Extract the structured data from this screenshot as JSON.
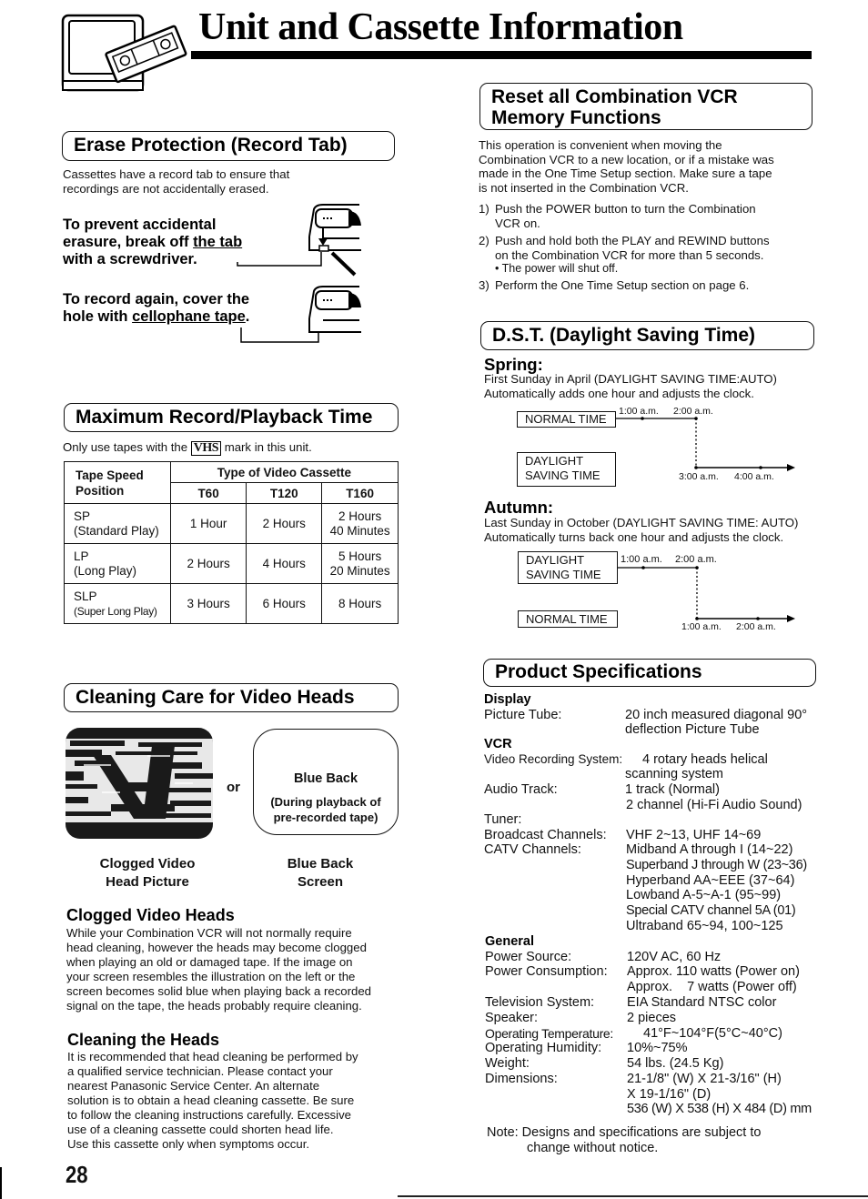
{
  "page": {
    "title": "Unit and Cassette Information",
    "page_number": "28"
  },
  "erase_protection": {
    "heading": "Erase Protection (Record Tab)",
    "intro_line1": "Cassettes have a record tab to ensure that",
    "intro_line2": "recordings are not accidentally erased.",
    "prevent_line1": "To prevent accidental",
    "prevent_line2a": "erasure, break off ",
    "prevent_line2b": "the tab",
    "prevent_line3": "with a screwdriver.",
    "record_line1": "To record again, cover the",
    "record_line2a": "hole with ",
    "record_line2b": "cellophane tape",
    "record_line2c": "."
  },
  "max_time": {
    "heading": "Maximum Record/Playback Time",
    "note_before": "Only use tapes with the",
    "vhs_mark": "VHS",
    "note_after": "mark in this unit.",
    "table": {
      "col0_header_line1": "Tape Speed",
      "col0_header_line2": "Position",
      "group_header": "Type of Video Cassette",
      "columns": [
        "T60",
        "T120",
        "T160"
      ],
      "rows": [
        {
          "speed": "SP",
          "speed_desc": "(Standard Play)",
          "values": [
            "1 Hour",
            "2 Hours",
            "2 Hours",
            "40 Minutes"
          ]
        },
        {
          "speed": "LP",
          "speed_desc": "(Long Play)",
          "values": [
            "2 Hours",
            "4 Hours",
            "5 Hours",
            "20 Minutes"
          ]
        },
        {
          "speed": "SLP",
          "speed_desc": "(Super Long Play)",
          "values": [
            "3 Hours",
            "6 Hours",
            "8 Hours",
            ""
          ]
        }
      ]
    }
  },
  "cleaning": {
    "heading": "Cleaning Care for Video Heads",
    "or_label": "or",
    "blue_back_title": "Blue Back",
    "blue_back_line1": "(During playback of",
    "blue_back_line2": "pre-recorded tape)",
    "caption_left_line1": "Clogged Video",
    "caption_left_line2": "Head Picture",
    "caption_right_line1": "Blue Back",
    "caption_right_line2": "Screen",
    "clogged_heading": "Clogged Video Heads",
    "clogged_lines": [
      "While your Combination VCR will not normally require",
      "head cleaning, however the heads may become clogged",
      "when playing an old or damaged tape. If the image on",
      "your screen resembles the illustration on the left or the",
      "screen becomes solid blue when playing back a recorded",
      "signal on the tape, the heads probably require cleaning."
    ],
    "cleaning_heading": "Cleaning the Heads",
    "cleaning_lines": [
      "It is recommended that head cleaning be performed by",
      "a qualified service technician. Please contact your",
      "nearest Panasonic Service Center.  An alternate",
      "solution is to obtain a head cleaning cassette.  Be sure",
      "to follow the cleaning instructions carefully.  Excessive",
      "use of a cleaning cassette could shorten head life.",
      "Use this cassette only when symptoms occur."
    ]
  },
  "reset": {
    "heading_line1": "Reset all Combination VCR",
    "heading_line2": "Memory Functions",
    "intro_lines": [
      "This operation is convenient when moving the",
      "Combination VCR to a new location, or if a mistake was",
      "made in the One Time Setup section. Make sure a tape",
      "is not inserted in the Combination VCR."
    ],
    "steps": [
      {
        "num": "1)",
        "lines": [
          "Push the POWER button to turn the Combination",
          "VCR on."
        ]
      },
      {
        "num": "2)",
        "lines": [
          "Push and hold both the PLAY and REWIND buttons",
          "on the Combination VCR for more than 5 seconds.",
          "• The power will shut off."
        ]
      },
      {
        "num": "3)",
        "lines": [
          "Perform the One Time Setup section on page 6."
        ]
      }
    ]
  },
  "dst": {
    "heading": "D.S.T. (Daylight Saving Time)",
    "spring": {
      "heading": "Spring:",
      "line1": "First Sunday in April (DAYLIGHT SAVING TIME:AUTO)",
      "line2": "Automatically adds one hour and adjusts the clock.",
      "top_box": "NORMAL TIME",
      "bottom_box_line1": "DAYLIGHT",
      "bottom_box_line2": "SAVING TIME",
      "top_t1": "1:00 a.m.",
      "top_t2": "2:00 a.m.",
      "bottom_t1": "3:00 a.m.",
      "bottom_t2": "4:00 a.m."
    },
    "autumn": {
      "heading": "Autumn:",
      "line1": "Last Sunday in October (DAYLIGHT SAVING TIME: AUTO)",
      "line2": "Automatically turns back one hour and adjusts the clock.",
      "top_box_line1": "DAYLIGHT",
      "top_box_line2": "SAVING TIME",
      "bottom_box": "NORMAL TIME",
      "top_t1": "1:00 a.m.",
      "top_t2": "2:00 a.m.",
      "bottom_t1": "1:00 a.m.",
      "bottom_t2": "2:00 a.m."
    }
  },
  "specs": {
    "heading": "Product Specifications",
    "display_heading": "Display",
    "vcr_heading": "VCR",
    "general_heading": "General",
    "picture_tube_label": "Picture Tube:",
    "picture_tube_value1": "20 inch measured diagonal 90°",
    "picture_tube_value2": "deflection Picture Tube",
    "video_rec_label": "Video Recording System:",
    "video_rec_value1": "4 rotary heads helical",
    "video_rec_value2": "scanning system",
    "audio_label": "Audio Track:",
    "audio_value1": "1 track (Normal)",
    "audio_value2": "2 channel (Hi-Fi Audio Sound)",
    "tuner_label": "Tuner:",
    "broadcast_label": "Broadcast Channels:",
    "broadcast_value": "VHF 2~13, UHF 14~69",
    "catv_label": "CATV Channels:",
    "catv_values": [
      "Midband A through I (14~22)",
      "Superband J through W (23~36)",
      "Hyperband AA~EEE (37~64)",
      "Lowband A-5~A-1 (95~99)",
      "Special CATV channel 5A (01)",
      "Ultraband 65~94, 100~125"
    ],
    "power_source_label": "Power Source:",
    "power_source_value": "120V AC, 60 Hz",
    "power_cons_label": "Power Consumption:",
    "power_cons_value1": "Approx. 110 watts (Power on)",
    "power_cons_value2": "Approx.    7 watts (Power off)",
    "tv_system_label": "Television System:",
    "tv_system_value": "EIA Standard NTSC color",
    "speaker_label": "Speaker:",
    "speaker_value": "2 pieces",
    "op_temp_label": "Operating Temperature:",
    "op_temp_value": "41°F~104°F(5°C~40°C)",
    "op_hum_label": "Operating Humidity:",
    "op_hum_value": "10%~75%",
    "weight_label": "Weight:",
    "weight_value": "54 lbs. (24.5 Kg)",
    "dim_label": "Dimensions:",
    "dim_value1": "21-1/8\" (W) X 21-3/16\" (H)",
    "dim_value2": "X 19-1/16\" (D)",
    "dim_value3": "536 (W) X 538 (H) X 484 (D) mm",
    "note_line1": "Note: Designs and specifications are subject to",
    "note_line2": "change without notice."
  }
}
